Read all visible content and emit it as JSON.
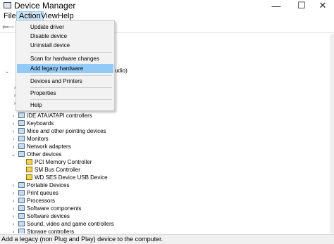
{
  "window": {
    "title": "Device Manager",
    "min_glyph": "—",
    "max_glyph": "☐",
    "close_glyph": "✕"
  },
  "menubar": {
    "items": [
      "File",
      "Action",
      "View",
      "Help"
    ]
  },
  "toolbar": {
    "back_glyph": "⇦",
    "forward_glyph": "⇨"
  },
  "action_menu": {
    "items": [
      "Update driver",
      "Disable device",
      "Uninstall device",
      "Scan for hardware changes",
      "Add legacy hardware",
      "Devices and Printers",
      "Properties",
      "Help"
    ],
    "highlighted": "Add legacy hardware"
  },
  "tree": {
    "partial_label": "udio)",
    "nodes": [
      {
        "label": "IDE ATA/ATAPI controllers",
        "expanded": false
      },
      {
        "label": "Keyboards",
        "expanded": false
      },
      {
        "label": "Mice and other pointing devices",
        "expanded": false
      },
      {
        "label": "Monitors",
        "expanded": false
      },
      {
        "label": "Network adapters",
        "expanded": false
      },
      {
        "label": "Other devices",
        "expanded": true
      },
      {
        "label": "PCI Memory Controller",
        "child": true
      },
      {
        "label": "SM Bus Controller",
        "child": true
      },
      {
        "label": "WD SES Device USB Device",
        "child": true
      },
      {
        "label": "Portable Devices",
        "expanded": false
      },
      {
        "label": "Print queues",
        "expanded": false
      },
      {
        "label": "Processors",
        "expanded": false
      },
      {
        "label": "Software components",
        "expanded": false
      },
      {
        "label": "Software devices",
        "expanded": false
      },
      {
        "label": "Sound, video and game controllers",
        "expanded": false
      },
      {
        "label": "Storage controllers",
        "expanded": false
      }
    ],
    "expand_glyph": "›",
    "collapse_glyph": "⌄"
  },
  "statusbar": {
    "text": "Add a legacy (non Plug and Play) device to the computer."
  },
  "colors": {
    "menu_highlight": "#91c9f7",
    "active_menu": "#cce4f7"
  }
}
